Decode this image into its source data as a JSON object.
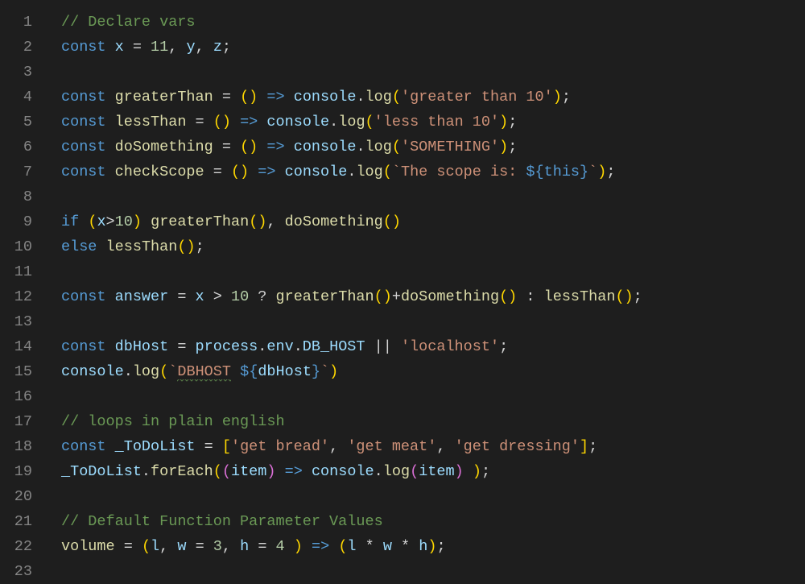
{
  "lines": [
    {
      "n": "1",
      "tokens": [
        [
          "c-comment",
          "// Declare vars"
        ]
      ]
    },
    {
      "n": "2",
      "tokens": [
        [
          "c-keyword",
          "const"
        ],
        [
          "",
          ""
        ],
        [
          "c-var",
          " x"
        ],
        [
          "c-op",
          " = "
        ],
        [
          "c-number",
          "11"
        ],
        [
          "c-punct",
          ", "
        ],
        [
          "c-var",
          "y"
        ],
        [
          "c-punct",
          ", "
        ],
        [
          "c-var",
          "z"
        ],
        [
          "c-punct",
          ";"
        ]
      ]
    },
    {
      "n": "3",
      "tokens": []
    },
    {
      "n": "4",
      "tokens": [
        [
          "c-keyword",
          "const"
        ],
        [
          "c-func",
          " greaterThan"
        ],
        [
          "c-op",
          " = "
        ],
        [
          "c-paren",
          "()"
        ],
        [
          "c-op",
          " "
        ],
        [
          "c-arrow",
          "=>"
        ],
        [
          "c-op",
          " "
        ],
        [
          "c-var",
          "console"
        ],
        [
          "c-punct",
          "."
        ],
        [
          "c-func",
          "log"
        ],
        [
          "c-paren",
          "("
        ],
        [
          "c-string",
          "'greater than 10'"
        ],
        [
          "c-paren",
          ")"
        ],
        [
          "c-punct",
          ";"
        ]
      ]
    },
    {
      "n": "5",
      "tokens": [
        [
          "c-keyword",
          "const"
        ],
        [
          "c-func",
          " lessThan"
        ],
        [
          "c-op",
          " = "
        ],
        [
          "c-paren",
          "()"
        ],
        [
          "c-op",
          " "
        ],
        [
          "c-arrow",
          "=>"
        ],
        [
          "c-op",
          " "
        ],
        [
          "c-var",
          "console"
        ],
        [
          "c-punct",
          "."
        ],
        [
          "c-func",
          "log"
        ],
        [
          "c-paren",
          "("
        ],
        [
          "c-string",
          "'less than 10'"
        ],
        [
          "c-paren",
          ")"
        ],
        [
          "c-punct",
          ";"
        ]
      ]
    },
    {
      "n": "6",
      "tokens": [
        [
          "c-keyword",
          "const"
        ],
        [
          "c-func",
          " doSomething"
        ],
        [
          "c-op",
          " = "
        ],
        [
          "c-paren",
          "()"
        ],
        [
          "c-op",
          " "
        ],
        [
          "c-arrow",
          "=>"
        ],
        [
          "c-op",
          " "
        ],
        [
          "c-var",
          "console"
        ],
        [
          "c-punct",
          "."
        ],
        [
          "c-func",
          "log"
        ],
        [
          "c-paren",
          "("
        ],
        [
          "c-string",
          "'SOMETHING'"
        ],
        [
          "c-paren",
          ")"
        ],
        [
          "c-punct",
          ";"
        ]
      ]
    },
    {
      "n": "7",
      "tokens": [
        [
          "c-keyword",
          "const"
        ],
        [
          "c-func",
          " checkScope"
        ],
        [
          "c-op",
          " = "
        ],
        [
          "c-paren",
          "()"
        ],
        [
          "c-op",
          " "
        ],
        [
          "c-arrow",
          "=>"
        ],
        [
          "c-op",
          " "
        ],
        [
          "c-var",
          "console"
        ],
        [
          "c-punct",
          "."
        ],
        [
          "c-func",
          "log"
        ],
        [
          "c-paren",
          "("
        ],
        [
          "c-string",
          "`The scope is: "
        ],
        [
          "c-templ",
          "${"
        ],
        [
          "c-this",
          "this"
        ],
        [
          "c-templ",
          "}"
        ],
        [
          "c-string",
          "`"
        ],
        [
          "c-paren",
          ")"
        ],
        [
          "c-punct",
          ";"
        ]
      ]
    },
    {
      "n": "8",
      "tokens": []
    },
    {
      "n": "9",
      "tokens": [
        [
          "c-keyword",
          "if"
        ],
        [
          "c-op",
          " "
        ],
        [
          "c-paren",
          "("
        ],
        [
          "c-var",
          "x"
        ],
        [
          "c-op",
          ">"
        ],
        [
          "c-number",
          "10"
        ],
        [
          "c-paren",
          ")"
        ],
        [
          "c-op",
          " "
        ],
        [
          "c-func",
          "greaterThan"
        ],
        [
          "c-paren",
          "()"
        ],
        [
          "c-punct",
          ", "
        ],
        [
          "c-func",
          "doSomething"
        ],
        [
          "c-paren",
          "()"
        ]
      ]
    },
    {
      "n": "10",
      "tokens": [
        [
          "c-keyword",
          "else"
        ],
        [
          "c-op",
          " "
        ],
        [
          "c-func",
          "lessThan"
        ],
        [
          "c-paren",
          "()"
        ],
        [
          "c-punct",
          ";"
        ]
      ]
    },
    {
      "n": "11",
      "tokens": []
    },
    {
      "n": "12",
      "tokens": [
        [
          "c-keyword",
          "const"
        ],
        [
          "c-var",
          " answer"
        ],
        [
          "c-op",
          " = "
        ],
        [
          "c-var",
          "x"
        ],
        [
          "c-op",
          " > "
        ],
        [
          "c-number",
          "10"
        ],
        [
          "c-op",
          " ? "
        ],
        [
          "c-func",
          "greaterThan"
        ],
        [
          "c-paren",
          "()"
        ],
        [
          "c-op",
          "+"
        ],
        [
          "c-func",
          "doSomething"
        ],
        [
          "c-paren",
          "()"
        ],
        [
          "c-op",
          " : "
        ],
        [
          "c-func",
          "lessThan"
        ],
        [
          "c-paren",
          "()"
        ],
        [
          "c-punct",
          ";"
        ]
      ]
    },
    {
      "n": "13",
      "tokens": []
    },
    {
      "n": "14",
      "tokens": [
        [
          "c-keyword",
          "const"
        ],
        [
          "c-var",
          " dbHost"
        ],
        [
          "c-op",
          " = "
        ],
        [
          "c-var",
          "process"
        ],
        [
          "c-punct",
          "."
        ],
        [
          "c-var",
          "env"
        ],
        [
          "c-punct",
          "."
        ],
        [
          "c-var",
          "DB_HOST"
        ],
        [
          "c-op",
          " || "
        ],
        [
          "c-string",
          "'localhost'"
        ],
        [
          "c-punct",
          ";"
        ]
      ]
    },
    {
      "n": "15",
      "tokens": [
        [
          "c-var",
          "console"
        ],
        [
          "c-punct",
          "."
        ],
        [
          "c-func",
          "log"
        ],
        [
          "c-paren",
          "("
        ],
        [
          "c-string",
          "`"
        ],
        [
          "c-string squiggle",
          "DBHOST"
        ],
        [
          "c-string",
          " "
        ],
        [
          "c-templ",
          "${"
        ],
        [
          "c-var",
          "dbHost"
        ],
        [
          "c-templ",
          "}"
        ],
        [
          "c-string",
          "`"
        ],
        [
          "c-paren",
          ")"
        ]
      ]
    },
    {
      "n": "16",
      "tokens": []
    },
    {
      "n": "17",
      "tokens": [
        [
          "c-comment",
          "// loops in plain english"
        ]
      ]
    },
    {
      "n": "18",
      "tokens": [
        [
          "c-keyword",
          "const"
        ],
        [
          "c-var",
          " _ToDoList"
        ],
        [
          "c-op",
          " = "
        ],
        [
          "c-paren",
          "["
        ],
        [
          "c-string",
          "'get bread'"
        ],
        [
          "c-punct",
          ", "
        ],
        [
          "c-string",
          "'get meat'"
        ],
        [
          "c-punct",
          ", "
        ],
        [
          "c-string",
          "'get dressing'"
        ],
        [
          "c-paren",
          "]"
        ],
        [
          "c-punct",
          ";"
        ]
      ]
    },
    {
      "n": "19",
      "tokens": [
        [
          "c-var",
          "_ToDoList"
        ],
        [
          "c-punct",
          "."
        ],
        [
          "c-func",
          "forEach"
        ],
        [
          "c-paren",
          "("
        ],
        [
          "c-paren-p",
          "("
        ],
        [
          "c-var",
          "item"
        ],
        [
          "c-paren-p",
          ")"
        ],
        [
          "c-op",
          " "
        ],
        [
          "c-arrow",
          "=>"
        ],
        [
          "c-op",
          " "
        ],
        [
          "c-var",
          "console"
        ],
        [
          "c-punct",
          "."
        ],
        [
          "c-func",
          "log"
        ],
        [
          "c-paren-p",
          "("
        ],
        [
          "c-var",
          "item"
        ],
        [
          "c-paren-p",
          ")"
        ],
        [
          "c-op",
          " "
        ],
        [
          "c-paren",
          ")"
        ],
        [
          "c-punct",
          ";"
        ]
      ]
    },
    {
      "n": "20",
      "tokens": []
    },
    {
      "n": "21",
      "tokens": [
        [
          "c-comment",
          "// Default Function Parameter Values"
        ]
      ]
    },
    {
      "n": "22",
      "tokens": [
        [
          "c-func",
          "volume"
        ],
        [
          "c-op",
          " = "
        ],
        [
          "c-paren",
          "("
        ],
        [
          "c-var",
          "l"
        ],
        [
          "c-punct",
          ", "
        ],
        [
          "c-var",
          "w"
        ],
        [
          "c-op",
          " = "
        ],
        [
          "c-number",
          "3"
        ],
        [
          "c-punct",
          ", "
        ],
        [
          "c-var",
          "h"
        ],
        [
          "c-op",
          " = "
        ],
        [
          "c-number",
          "4"
        ],
        [
          "c-op",
          " "
        ],
        [
          "c-paren",
          ")"
        ],
        [
          "c-op",
          " "
        ],
        [
          "c-arrow",
          "=>"
        ],
        [
          "c-op",
          " "
        ],
        [
          "c-paren",
          "("
        ],
        [
          "c-var",
          "l"
        ],
        [
          "c-op",
          " * "
        ],
        [
          "c-var",
          "w"
        ],
        [
          "c-op",
          " * "
        ],
        [
          "c-var",
          "h"
        ],
        [
          "c-paren",
          ")"
        ],
        [
          "c-punct",
          ";"
        ]
      ]
    },
    {
      "n": "23",
      "tokens": []
    }
  ]
}
